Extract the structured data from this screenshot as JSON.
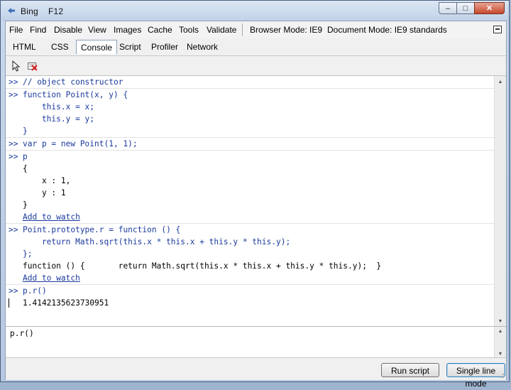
{
  "window": {
    "title": "Bing",
    "subtitle": "F12",
    "min_glyph": "–",
    "max_glyph": "□",
    "close_glyph": "✕"
  },
  "menu": {
    "items": [
      "File",
      "Find",
      "Disable",
      "View",
      "Images",
      "Cache",
      "Tools",
      "Validate"
    ],
    "browser_mode": "Browser Mode: IE9",
    "document_mode": "Document Mode: IE9 standards"
  },
  "tabs": [
    "HTML",
    "CSS",
    "Console",
    "Script",
    "Profiler",
    "Network"
  ],
  "active_tab": "Console",
  "toolbar": {
    "icons": [
      "select-element-icon",
      "clear-console-icon"
    ]
  },
  "console": {
    "prompt": ">>",
    "entries": [
      {
        "input": [
          "// object constructor"
        ]
      },
      {
        "input": [
          "function Point(x, y) {",
          "    this.x = x;",
          "    this.y = y;",
          "}"
        ]
      },
      {
        "input": [
          "var p = new Point(1, 1);"
        ]
      },
      {
        "input": [
          "p"
        ],
        "output": [
          "{",
          "    x : 1,",
          "    y : 1",
          "}"
        ],
        "link": "Add to watch"
      },
      {
        "input": [
          "Point.prototype.r = function () {",
          "    return Math.sqrt(this.x * this.x + this.y * this.y);",
          "};"
        ],
        "output": [
          "function () {       return Math.sqrt(this.x * this.x + this.y * this.y);  }"
        ],
        "link": "Add to watch"
      },
      {
        "input": [
          "p.r()"
        ],
        "output": [
          "1.4142135623730951"
        ]
      }
    ]
  },
  "input": {
    "value": "p.r()"
  },
  "buttons": {
    "run": "Run script",
    "mode": "Single line mode"
  }
}
